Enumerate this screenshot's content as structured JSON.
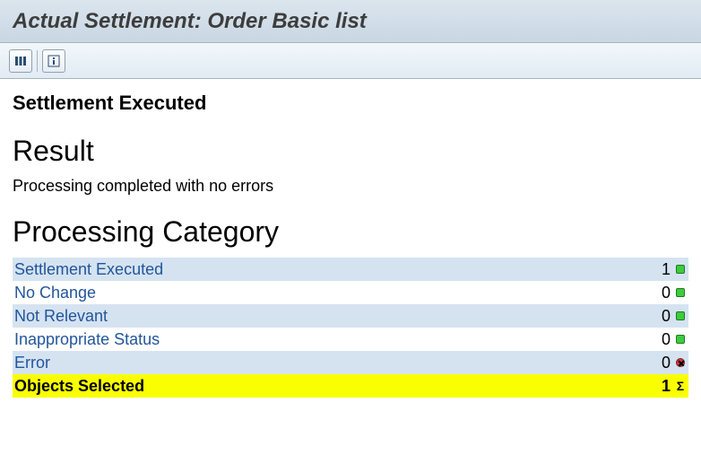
{
  "title": "Actual Settlement: Order Basic list",
  "subtitle": "Settlement Executed",
  "result": {
    "heading": "Result",
    "message": "Processing completed with no errors"
  },
  "processing_category": {
    "heading": "Processing Category",
    "rows": [
      {
        "label": "Settlement Executed",
        "count": "1",
        "status": "green",
        "shaded": true
      },
      {
        "label": "No Change",
        "count": "0",
        "status": "green",
        "shaded": false
      },
      {
        "label": "Not Relevant",
        "count": "0",
        "status": "green",
        "shaded": true
      },
      {
        "label": "Inappropriate Status",
        "count": "0",
        "status": "green",
        "shaded": false
      },
      {
        "label": "Error",
        "count": "0",
        "status": "red",
        "shaded": true
      }
    ],
    "total": {
      "label": "Objects Selected",
      "count": "1"
    }
  }
}
